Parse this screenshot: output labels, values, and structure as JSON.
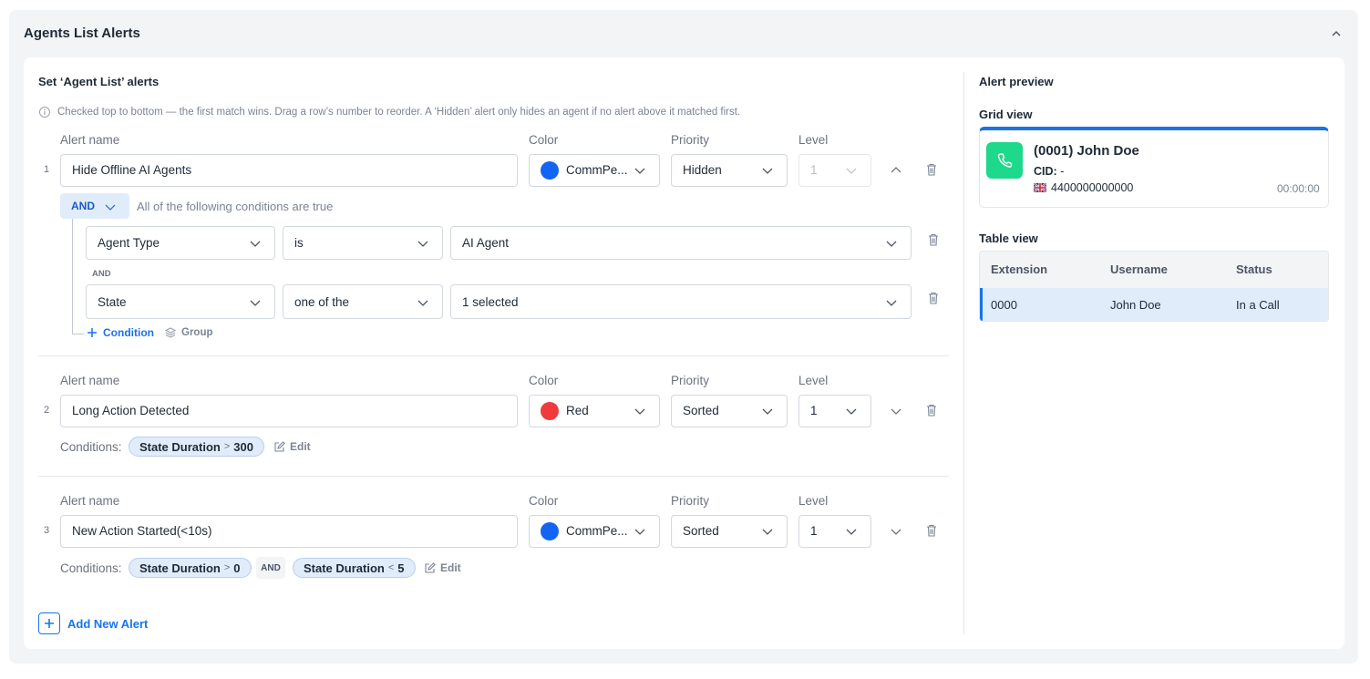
{
  "header": {
    "title": "Agents List Alerts"
  },
  "editor": {
    "title": "Set ‘Agent List’ alerts",
    "hint": "Checked top to bottom — the first match wins. Drag a row’s number to reorder. A ‘Hidden’ alert only hides an agent if no alert above it matched first.",
    "col_alert_name": "Alert name",
    "col_color": "Color",
    "col_priority": "Priority",
    "col_level": "Level",
    "add_alert_label": "Add New Alert",
    "conditions_label": "Conditions:",
    "edit_label": "Edit",
    "alerts": [
      {
        "number": "1",
        "name": "Hide Offline AI Agents",
        "color_name": "CommPe...",
        "color_hex": "#1464f4",
        "priority": "Hidden",
        "level": "1",
        "logic": "AND",
        "logic_desc": "All of the following conditions are true",
        "conditions": [
          {
            "field": "Agent Type",
            "operator": "is",
            "value": "AI Agent"
          },
          {
            "field": "State",
            "operator": "one of the",
            "value": "1 selected"
          }
        ],
        "joiner": "AND",
        "add_condition_label": "Condition",
        "add_group_label": "Group"
      },
      {
        "number": "2",
        "name": "Long Action Detected",
        "color_name": "Red",
        "color_hex": "#ef3b3b",
        "priority": "Sorted",
        "level": "1",
        "chips": [
          {
            "field": "State Duration",
            "op": ">",
            "value": "300"
          }
        ]
      },
      {
        "number": "3",
        "name": "New Action Started(<10s)",
        "color_name": "CommPe...",
        "color_hex": "#1464f4",
        "priority": "Sorted",
        "level": "1",
        "chips": [
          {
            "field": "State Duration",
            "op": ">",
            "value": "0"
          },
          {
            "field": "State Duration",
            "op": "<",
            "value": "5"
          }
        ],
        "chip_joiner": "AND"
      }
    ]
  },
  "preview": {
    "title": "Alert preview",
    "grid_title": "Grid view",
    "card": {
      "name": "(0001) John Doe",
      "cid_label": "CID:",
      "cid_value": "-",
      "phone": "4400000000000",
      "time": "00:00:00",
      "accent": "#1a73e8",
      "icon_bg": "#1ed88c"
    },
    "table_title": "Table view",
    "table": {
      "headers": [
        "Extension",
        "Username",
        "Status"
      ],
      "rows": [
        [
          "0000",
          "John Doe",
          "In a Call"
        ]
      ]
    }
  },
  "icons": {
    "collapse": "chevron-up-icon",
    "info": "info-icon",
    "delete": "trash-icon",
    "phone": "phone-icon",
    "flag": "uk-flag-icon",
    "layers": "layers-icon",
    "edit": "edit-icon",
    "add": "plus-icon"
  }
}
